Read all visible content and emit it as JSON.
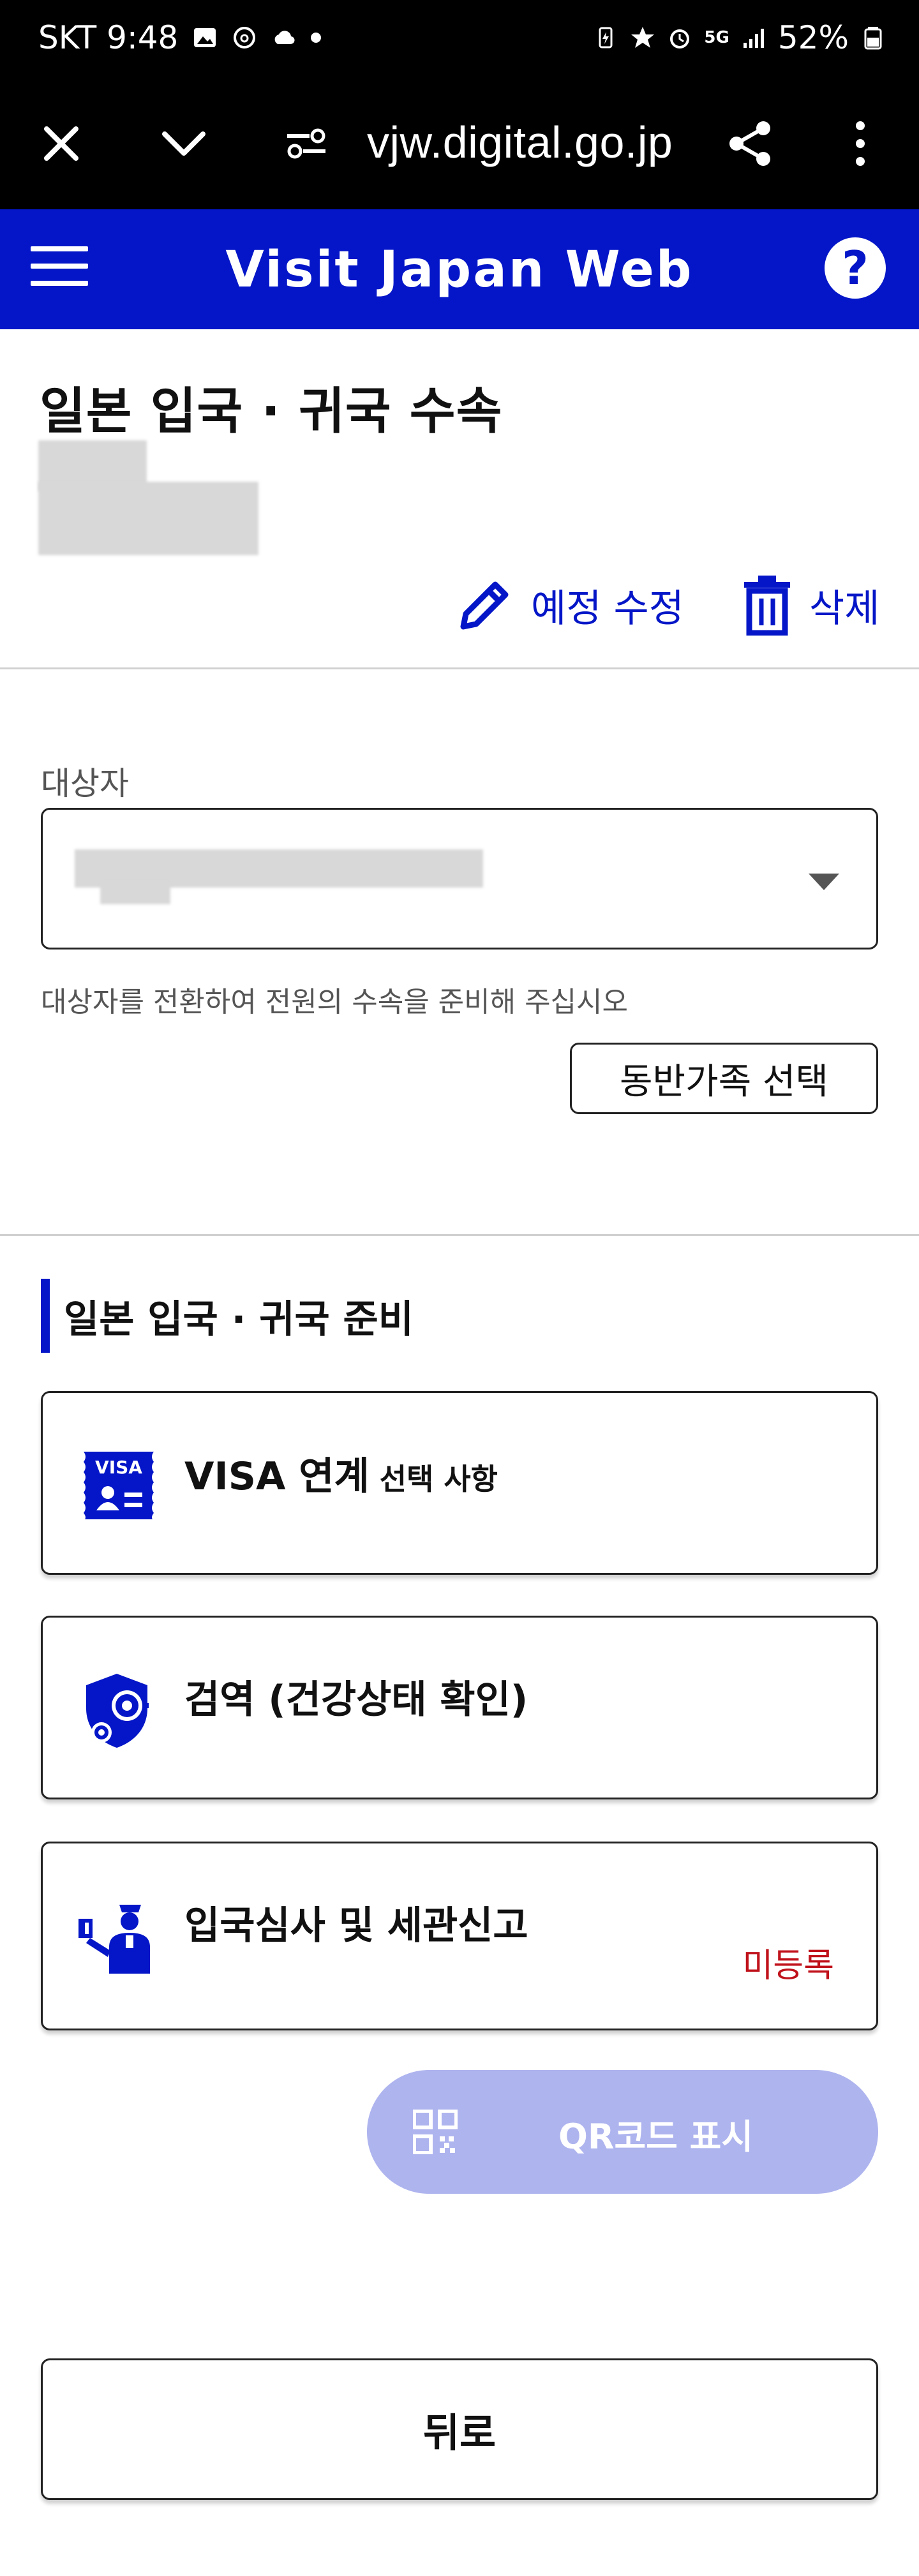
{
  "status_bar": {
    "carrier_time": "SKT 9:48",
    "battery": "52%",
    "network": "5G"
  },
  "browser": {
    "url": "vjw.digital.go.jp",
    "icons": [
      "close-icon",
      "chevron-down-icon",
      "page-info-icon",
      "share-icon",
      "more-vert-icon"
    ]
  },
  "header": {
    "title": "Visit Japan Web",
    "help_label": "?"
  },
  "page": {
    "title": "일본 입국 · 귀국 수속",
    "edit_label": "예정 수정",
    "delete_label": "삭제"
  },
  "target": {
    "label": "대상자",
    "hint": "대상자를 전환하여 전원의 수속을 준비해 주십시오",
    "family_button": "동반가족 선택"
  },
  "prep": {
    "heading": "일본 입국 · 귀국 준비",
    "cards": [
      {
        "title": "VISA 연계",
        "subtitle": "선택 사항",
        "icon": "visa-icon"
      },
      {
        "title": "검역 (건강상태 확인)",
        "icon": "quarantine-shield-icon"
      },
      {
        "title": "입국심사 및 세관신고",
        "status": "미등록",
        "icon": "immigration-officer-icon"
      }
    ],
    "qr_button": "QR코드 표시",
    "back_button": "뒤로"
  },
  "colors": {
    "brand": "#0416c7",
    "qr_disabled": "#aeb4ee",
    "status_unregistered": "#c0121b"
  }
}
